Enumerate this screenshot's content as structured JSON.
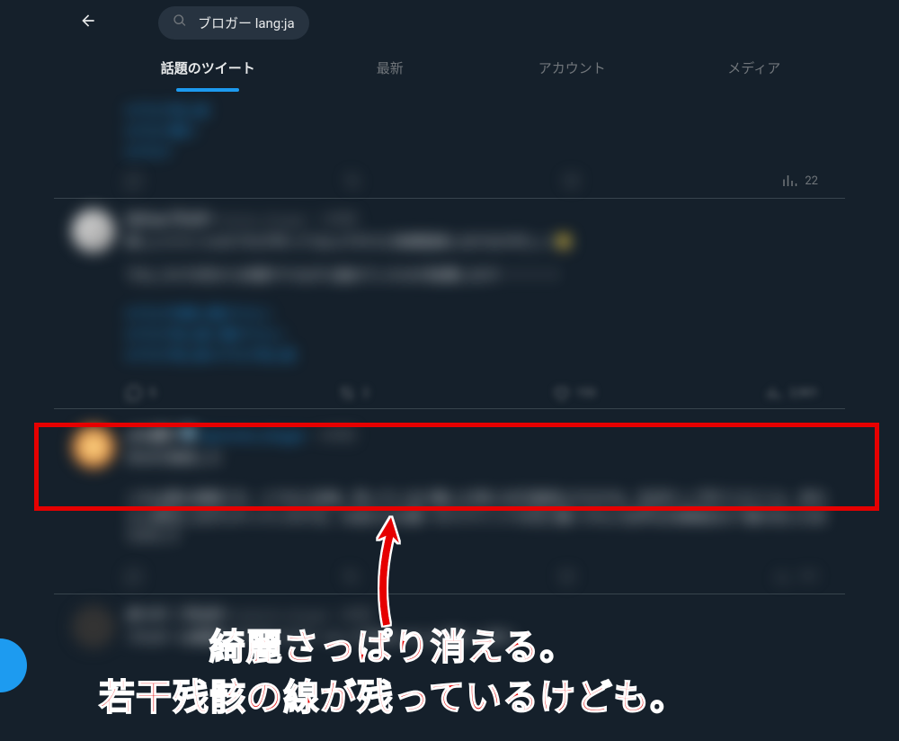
{
  "search": {
    "query": "ブロガー lang:ja"
  },
  "tabs": {
    "top": "話題のツイート",
    "latest": "最新",
    "accounts": "アカウント",
    "media": "メディア"
  },
  "tweet1": {
    "views": "22"
  },
  "tweet2_actions": {
    "reply": "5",
    "retweet": "2",
    "like": "153",
    "views": "2,901"
  },
  "annotation": {
    "line1": "綺麗さっぱり消える。",
    "line2": "若干残骸の線が残っているけども。"
  }
}
